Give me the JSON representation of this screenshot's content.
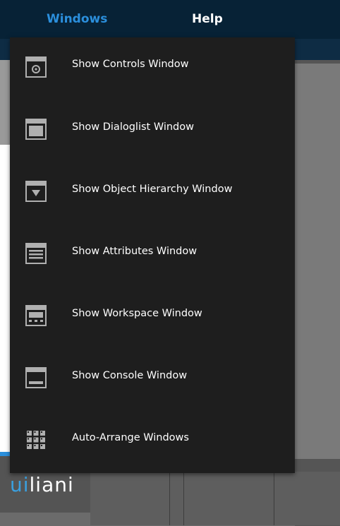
{
  "menubar": {
    "windows_label": "Windows",
    "help_label": "Help",
    "active_color": "#2b8fdc"
  },
  "dropdown": {
    "items": [
      {
        "label": "Show Controls Window",
        "icon": "controls-window-icon"
      },
      {
        "label": "Show Dialoglist Window",
        "icon": "dialoglist-window-icon"
      },
      {
        "label": "Show Object Hierarchy Window",
        "icon": "hierarchy-window-icon"
      },
      {
        "label": "Show Attributes Window",
        "icon": "attributes-window-icon"
      },
      {
        "label": "Show Workspace Window",
        "icon": "workspace-window-icon"
      },
      {
        "label": "Show Console Window",
        "icon": "console-window-icon"
      },
      {
        "label": "Auto-Arrange Windows",
        "icon": "auto-arrange-icon"
      }
    ]
  },
  "background": {
    "logo_text_accent": "ui",
    "logo_text_rest": "liani"
  }
}
